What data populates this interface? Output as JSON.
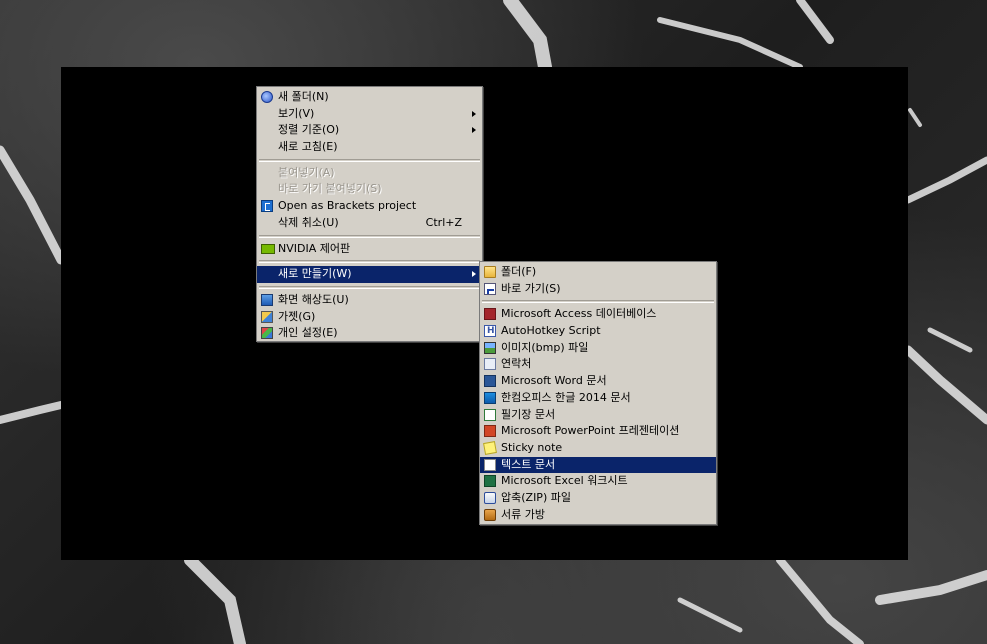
{
  "context_menu": {
    "items": [
      {
        "type": "item",
        "label": "새 폴더(N)",
        "icon": "new-folder-icon"
      },
      {
        "type": "item",
        "label": "보기(V)",
        "submenu": true
      },
      {
        "type": "item",
        "label": "정렬 기준(O)",
        "submenu": true
      },
      {
        "type": "item",
        "label": "새로 고침(E)"
      },
      {
        "type": "separator"
      },
      {
        "type": "item",
        "label": "붙여넣기(A)",
        "disabled": true
      },
      {
        "type": "item",
        "label": "바로 가기 붙여넣기(S)",
        "disabled": true
      },
      {
        "type": "item",
        "label": "Open as Brackets project",
        "icon": "brackets-icon"
      },
      {
        "type": "item",
        "label": "삭제 취소(U)",
        "shortcut": "Ctrl+Z"
      },
      {
        "type": "separator"
      },
      {
        "type": "item",
        "label": "NVIDIA 제어판",
        "icon": "nvidia-icon"
      },
      {
        "type": "separator"
      },
      {
        "type": "item",
        "label": "새로 만들기(W)",
        "submenu": true,
        "selected": true
      },
      {
        "type": "separator"
      },
      {
        "type": "item",
        "label": "화면 해상도(U)",
        "icon": "screen-resolution-icon"
      },
      {
        "type": "item",
        "label": "가젯(G)",
        "icon": "gadget-icon"
      },
      {
        "type": "item",
        "label": "개인 설정(E)",
        "icon": "personalize-icon"
      }
    ]
  },
  "new_submenu": {
    "items": [
      {
        "type": "item",
        "label": "폴더(F)",
        "icon": "folder-icon"
      },
      {
        "type": "item",
        "label": "바로 가기(S)",
        "icon": "shortcut-icon"
      },
      {
        "type": "separator"
      },
      {
        "type": "item",
        "label": "Microsoft Access 데이터베이스",
        "icon": "access-icon"
      },
      {
        "type": "item",
        "label": "AutoHotkey Script",
        "icon": "autohotkey-icon"
      },
      {
        "type": "item",
        "label": "이미지(bmp) 파일",
        "icon": "bitmap-icon"
      },
      {
        "type": "item",
        "label": "연락처",
        "icon": "contact-icon"
      },
      {
        "type": "item",
        "label": "Microsoft Word 문서",
        "icon": "word-icon"
      },
      {
        "type": "item",
        "label": "한컴오피스 한글 2014 문서",
        "icon": "hwp-icon"
      },
      {
        "type": "item",
        "label": "필기장 문서",
        "icon": "journal-icon"
      },
      {
        "type": "item",
        "label": "Microsoft PowerPoint 프레젠테이션",
        "icon": "powerpoint-icon"
      },
      {
        "type": "item",
        "label": "Sticky note",
        "icon": "sticky-note-icon"
      },
      {
        "type": "item",
        "label": "텍스트 문서",
        "icon": "text-document-icon",
        "selected": true
      },
      {
        "type": "item",
        "label": "Microsoft Excel 워크시트",
        "icon": "excel-icon"
      },
      {
        "type": "item",
        "label": "압축(ZIP) 파일",
        "icon": "zip-icon"
      },
      {
        "type": "item",
        "label": "서류 가방",
        "icon": "briefcase-icon"
      }
    ]
  },
  "colors": {
    "menu_bg": "#d4d0c8",
    "selection": "#0a246a",
    "screen": "#000000"
  }
}
